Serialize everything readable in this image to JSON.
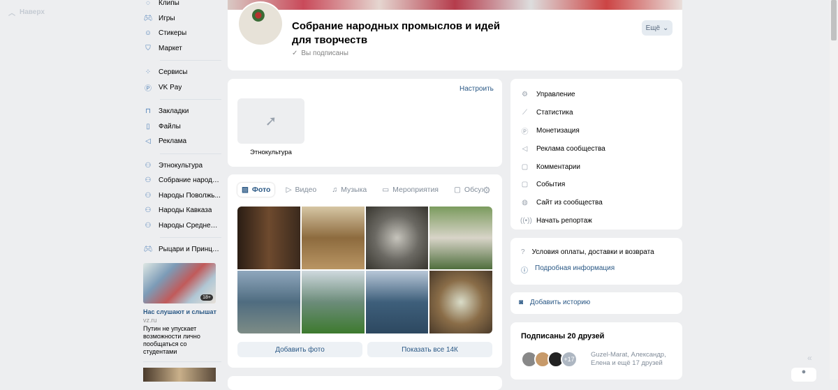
{
  "top_button": "Наверх",
  "nav": {
    "items": [
      {
        "label": "Клипы",
        "icon": "clips-icon"
      },
      {
        "label": "Игры",
        "icon": "gamepad-icon"
      },
      {
        "label": "Стикеры",
        "icon": "smile-icon"
      },
      {
        "label": "Маркет",
        "icon": "bag-icon"
      },
      {
        "label": "Сервисы",
        "icon": "services-icon"
      },
      {
        "label": "VK Pay",
        "icon": "vkpay-icon"
      },
      {
        "label": "Закладки",
        "icon": "bookmark-icon"
      },
      {
        "label": "Файлы",
        "icon": "file-icon"
      },
      {
        "label": "Реклама",
        "icon": "megaphone-icon"
      },
      {
        "label": "Этнокультура",
        "icon": "group-icon"
      },
      {
        "label": "Собрание народн...",
        "icon": "group-icon"
      },
      {
        "label": "Народы Поволжь...",
        "icon": "group-icon"
      },
      {
        "label": "Народы Кавказа",
        "icon": "group-icon"
      },
      {
        "label": "Народы Средней ...",
        "icon": "group-icon"
      },
      {
        "label": "Рыцари и Принце...",
        "icon": "gamepad-icon"
      }
    ]
  },
  "ad": {
    "badge": "18+",
    "title": "Нас слушают и слышат",
    "source": "vz.ru",
    "text": "Путин не упускает возможности лично пообщаться со студентами"
  },
  "header": {
    "title": "Собрание народных промыслов и идей для творчеств",
    "status": "Вы подписаны",
    "more": "Ещё"
  },
  "links_block": {
    "configure": "Настроить",
    "tile_label": "Этнокультура"
  },
  "media": {
    "tabs": [
      "Фото",
      "Видео",
      "Музыка",
      "Мероприятия",
      "Обсуждения"
    ],
    "add_photo": "Добавить фото",
    "show_all": "Показать все 14К"
  },
  "admin_menu": [
    "Управление",
    "Статистика",
    "Монетизация",
    "Реклама сообщества",
    "Комментарии",
    "События",
    "Сайт из сообщества",
    "Начать репортаж"
  ],
  "info": {
    "terms": "Условия оплаты, доставки и возврата",
    "details": "Подробная информация"
  },
  "story": "Добавить историю",
  "friends": {
    "title": "Подписаны 20 друзей",
    "more_count": "+17",
    "names": "Guzel-Marat, Александр,",
    "names2": "Елена и ещё 17 друзей"
  },
  "colors": {
    "accent": "#2a5885",
    "bg": "#edeef0"
  }
}
